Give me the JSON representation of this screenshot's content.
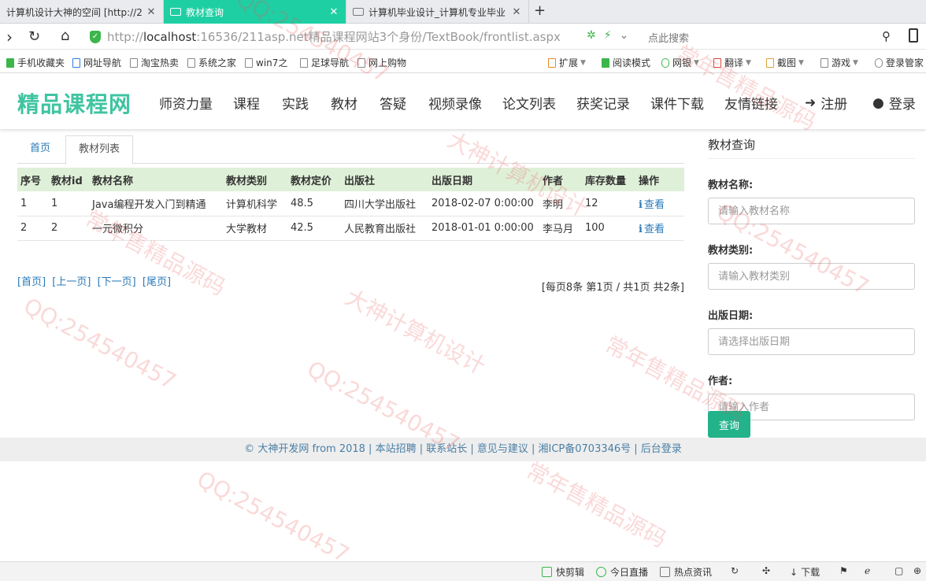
{
  "browser": {
    "tabs": [
      {
        "title": "计算机设计大神的空间 [http://2"
      },
      {
        "title": "教材查询"
      },
      {
        "title": "计算机毕业设计_计算机专业毕业"
      }
    ],
    "new_tab": "+",
    "url_prefix": "http://",
    "url_host": "localhost",
    "url_rest": ":16536/211asp.net精品课程网站3个身份/TextBook/frontlist.aspx",
    "search_placeholder": "点此搜索",
    "bookmarks": [
      "手机收藏夹",
      "网址导航",
      "淘宝热卖",
      "系统之家",
      "win7之",
      "足球导航",
      "网上购物"
    ],
    "tools": [
      "扩展",
      "阅读模式",
      "网银",
      "翻译",
      "截图",
      "游戏",
      "登录管家"
    ]
  },
  "site": {
    "logo": "精品课程网",
    "nav": [
      "师资力量",
      "课程",
      "实践",
      "教材",
      "答疑",
      "视频录像",
      "论文列表",
      "获奖记录",
      "课件下载",
      "友情链接"
    ],
    "register": "注册",
    "login": "登录"
  },
  "breadcrumb": {
    "home": "首页",
    "current": "教材列表"
  },
  "table": {
    "headers": [
      "序号",
      "教材id",
      "教材名称",
      "教材类别",
      "教材定价",
      "出版社",
      "出版日期",
      "作者",
      "库存数量",
      "操作"
    ],
    "rows": [
      [
        "1",
        "1",
        "Java编程开发入门到精通",
        "计算机科学",
        "48.5",
        "四川大学出版社",
        "2018-02-07 0:00:00",
        "李明",
        "12",
        "查看"
      ],
      [
        "2",
        "2",
        "一元微积分",
        "大学教材",
        "42.5",
        "人民教育出版社",
        "2018-01-01 0:00:00",
        "李马月",
        "100",
        "查看"
      ]
    ]
  },
  "pager": {
    "first": "[首页]",
    "prev": "[上一页]",
    "next": "[下一页]",
    "last": "[尾页]",
    "info": "[每页8条 第1页 / 共1页 共2条]"
  },
  "sidebar": {
    "title": "教材查询",
    "fields": [
      {
        "label": "教材名称:",
        "placeholder": "请输入教材名称"
      },
      {
        "label": "教材类别:",
        "placeholder": "请输入教材类别"
      },
      {
        "label": "出版日期:",
        "placeholder": "请选择出版日期"
      },
      {
        "label": "作者:",
        "placeholder": "请输入作者"
      }
    ],
    "query_button": "查询"
  },
  "footer": {
    "text": "© 大神开发网 from 2018 | 本站招聘 | 联系站长 | 意见与建议 | 湘ICP备0703346号 | 后台登录"
  },
  "statusbar": {
    "items": [
      "快剪辑",
      "今日直播",
      "热点资讯",
      "下载"
    ]
  },
  "watermarks": [
    "QQ:254540457",
    "常年售精品源码",
    "大神计算机设计"
  ],
  "colors": {
    "accent": "#3ec4a0",
    "active_tab": "#1fcfa4",
    "header_row": "#dff0d8",
    "link": "#2a7ab8",
    "button": "#23b38b"
  }
}
